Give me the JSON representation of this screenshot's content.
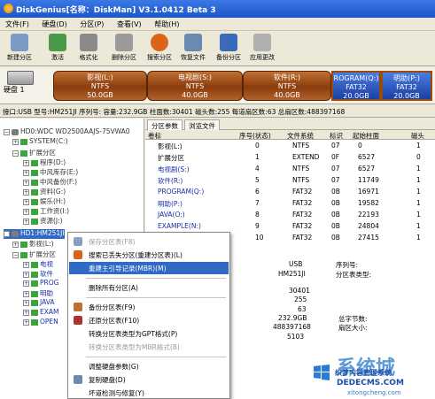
{
  "window": {
    "title": "DiskGenius[名称：DiskMan] V3.1.0412 Beta 3"
  },
  "menu": [
    "文件(F)",
    "硬盘(D)",
    "分区(P)",
    "查看(V)",
    "帮助(H)"
  ],
  "toolbar": [
    {
      "label": "新建分区",
      "icon": "new-partition-icon",
      "color": "#7a9bc4"
    },
    {
      "label": "激活",
      "icon": "activate-icon",
      "color": "#4a9a4a"
    },
    {
      "label": "格式化",
      "icon": "format-icon",
      "color": "#8a8a8a"
    },
    {
      "label": "删除分区",
      "icon": "delete-icon",
      "color": "#9a9a9a"
    },
    {
      "label": "搜索分区",
      "icon": "search-icon",
      "color": "#d9641a"
    },
    {
      "label": "恢复文件",
      "icon": "recover-icon",
      "color": "#6a8ab0"
    },
    {
      "label": "备份分区",
      "icon": "backup-icon",
      "color": "#3a6ab8"
    },
    {
      "label": "应用更改",
      "icon": "apply-icon",
      "color": "#b0b0b0"
    }
  ],
  "diskmap": {
    "disk_label": "硬盘 1",
    "segments": [
      {
        "name": "影视(L:)",
        "fs": "NTFS",
        "size": "50.0GB"
      },
      {
        "name": "电视剧(S:)",
        "fs": "NTFS",
        "size": "40.0GB"
      },
      {
        "name": "软件(R:)",
        "fs": "NTFS",
        "size": "40.0GB"
      },
      {
        "name": "ROGRAM(Q:)",
        "fs": "FAT32",
        "size": "20.0GB"
      },
      {
        "name": "明助(P:)",
        "fs": "FAT32",
        "size": "20.0GB"
      }
    ]
  },
  "infobar": "接口:USB  型号:HM251JI  序列号:  容量:232.9GB  柱面数:30401  磁头数:255  每道扇区数:63  总扇区数:488397168",
  "tree": [
    {
      "text": "HD0:WDC WD2500AAJS-75VWA0",
      "expander": "−",
      "icon": "disk",
      "style": "normal"
    },
    {
      "text": "SYSTEM(C:)",
      "expander": "+",
      "icon": "part",
      "style": "normal"
    },
    {
      "text": "扩展分区",
      "expander": "−",
      "icon": "part",
      "style": "normal"
    },
    {
      "text": "程序(D:)",
      "expander": "+",
      "icon": "part",
      "style": "normal"
    },
    {
      "text": "中风库存(E:)",
      "expander": "+",
      "icon": "part",
      "style": "normal"
    },
    {
      "text": "中风备份(F:)",
      "expander": "+",
      "icon": "part",
      "style": "normal"
    },
    {
      "text": "资料(G:)",
      "expander": "+",
      "icon": "part",
      "style": "normal"
    },
    {
      "text": "娱乐(H:)",
      "expander": "+",
      "icon": "part",
      "style": "normal"
    },
    {
      "text": "工作资(I:)",
      "expander": "+",
      "icon": "part",
      "style": "normal"
    },
    {
      "text": "资源(J:)",
      "expander": "+",
      "icon": "part",
      "style": "normal"
    },
    {
      "text": "HD1:HM251JI",
      "expander": "−",
      "icon": "disk",
      "style": "selected"
    },
    {
      "text": "影视(L:)",
      "expander": "+",
      "icon": "part",
      "style": "normal"
    },
    {
      "text": "扩展分区",
      "expander": "−",
      "icon": "part",
      "style": "normal"
    },
    {
      "text": "电视",
      "expander": "+",
      "icon": "part",
      "style": "blue"
    },
    {
      "text": "软件",
      "expander": "+",
      "icon": "part",
      "style": "blue"
    },
    {
      "text": "PROG",
      "expander": "+",
      "icon": "part",
      "style": "blue"
    },
    {
      "text": "明助",
      "expander": "+",
      "icon": "part",
      "style": "blue"
    },
    {
      "text": "JAVA",
      "expander": "+",
      "icon": "part",
      "style": "blue"
    },
    {
      "text": "EXAM",
      "expander": "+",
      "icon": "part",
      "style": "blue"
    },
    {
      "text": "OPEN",
      "expander": "+",
      "icon": "part",
      "style": "blue"
    }
  ],
  "tabs": [
    "分区参数",
    "浏览文件"
  ],
  "grid": {
    "headers": [
      "卷标",
      "序号(状态)",
      "文件系统",
      "标识",
      "起始柱面",
      "磁头"
    ],
    "rows": [
      [
        "影视(L:)",
        "0",
        "NTFS",
        "07",
        "0",
        "1"
      ],
      [
        "扩展分区",
        "1",
        "EXTEND",
        "0F",
        "6527",
        "0"
      ],
      [
        "电视剧(S:)",
        "4",
        "NTFS",
        "07",
        "6527",
        "1"
      ],
      [
        "软件(R:)",
        "5",
        "NTFS",
        "07",
        "11749",
        "1"
      ],
      [
        "PROGRAM(Q:)",
        "6",
        "FAT32",
        "0B",
        "16971",
        "1"
      ],
      [
        "明助(P:)",
        "7",
        "FAT32",
        "0B",
        "19582",
        "1"
      ],
      [
        "JAVA(O:)",
        "8",
        "FAT32",
        "0B",
        "22193",
        "1"
      ],
      [
        "EXAMPLE(N:)",
        "9",
        "FAT32",
        "0B",
        "24804",
        "1"
      ],
      [
        "",
        "10",
        "FAT32",
        "0B",
        "27415",
        "1"
      ]
    ]
  },
  "detail": {
    "usb": "USB",
    "serial_label": "序列号:",
    "model": "HM251JI",
    "table_type_label": "分区表类型:",
    "cylinders": "30401",
    "heads": "255",
    "sectors": "63",
    "capacity": "232.9GB",
    "total_bytes_label": "总字节数:",
    "total_sectors": "488397168",
    "sector_size_label": "扇区大小:",
    "last": "5103"
  },
  "context_menu": [
    {
      "label": "保存分区表(F8)",
      "state": "disabled",
      "icon": "save-icon"
    },
    {
      "label": "搜索已丢失分区(重建分区表)(L)",
      "state": "normal",
      "icon": "search-icon"
    },
    {
      "label": "重建主引导记录(MBR)(M)",
      "state": "highlighted",
      "icon": ""
    },
    {
      "sep": true
    },
    {
      "label": "删除所有分区(A)",
      "state": "normal",
      "icon": ""
    },
    {
      "sep": true
    },
    {
      "label": "备份分区表(F9)",
      "state": "normal",
      "icon": "backup-table-icon"
    },
    {
      "label": "还原分区表(F10)",
      "state": "normal",
      "icon": "restore-table-icon"
    },
    {
      "label": "转换分区表类型为GPT格式(P)",
      "state": "normal",
      "icon": ""
    },
    {
      "label": "转换分区表类型为MBR格式(B)",
      "state": "disabled",
      "icon": ""
    },
    {
      "sep": true
    },
    {
      "label": "调整硬盘参数(G)",
      "state": "normal",
      "icon": ""
    },
    {
      "label": "复制硬盘(D)",
      "state": "normal",
      "icon": "copy-disk-icon"
    },
    {
      "label": "坏道检测与修复(Y)",
      "state": "normal",
      "icon": ""
    }
  ],
  "watermark": {
    "logo_text": "系统城",
    "site_title": "织梦内容管理系统",
    "site_domain": "DEDECMS.COM",
    "site_url": "xitongcheng.com"
  }
}
